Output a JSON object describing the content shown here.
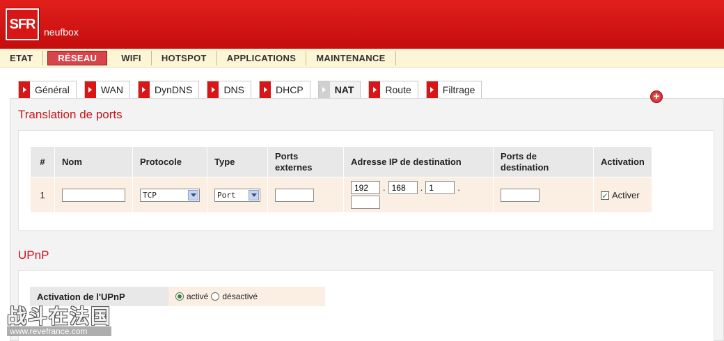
{
  "header": {
    "logo": "SFR",
    "brand": "neufbox"
  },
  "topnav": [
    {
      "label": "ETAT",
      "active": false
    },
    {
      "label": "RÉSEAU",
      "active": true
    },
    {
      "label": "WIFI",
      "active": false
    },
    {
      "label": "HOTSPOT",
      "active": false
    },
    {
      "label": "APPLICATIONS",
      "active": false
    },
    {
      "label": "MAINTENANCE",
      "active": false
    }
  ],
  "subtabs": [
    {
      "label": "Général",
      "active": false
    },
    {
      "label": "WAN",
      "active": false
    },
    {
      "label": "DynDNS",
      "active": false
    },
    {
      "label": "DNS",
      "active": false
    },
    {
      "label": "DHCP",
      "active": false
    },
    {
      "label": "NAT",
      "active": true
    },
    {
      "label": "Route",
      "active": false
    },
    {
      "label": "Filtrage",
      "active": false
    }
  ],
  "nat": {
    "title": "Translation de ports",
    "columns": {
      "num": "#",
      "nom": "Nom",
      "protocole": "Protocole",
      "type": "Type",
      "ports_externes": "Ports externes",
      "adresse_ip": "Adresse IP de destination",
      "ports_destination": "Ports de destination",
      "activation": "Activation"
    },
    "row": {
      "num": "1",
      "nom": "",
      "protocole": "TCP",
      "type": "Port",
      "ports_externes": "",
      "ip": [
        "192",
        "168",
        "1",
        ""
      ],
      "ip_sep": ".",
      "ports_destination": "",
      "activation_label": "Activer",
      "activation_checked": true
    }
  },
  "upnp": {
    "title": "UPnP",
    "label": "Activation de l'UPnP",
    "option_on": "activé",
    "option_off": "désactivé",
    "selected": "activé"
  },
  "watermark": {
    "text": "战斗在法国",
    "url": "www.revefrance.com"
  },
  "colors": {
    "brand_red": "#d71717",
    "title_red": "#c9141a",
    "row_bg": "#fbeee2",
    "header_bg": "#e8e8e8"
  }
}
